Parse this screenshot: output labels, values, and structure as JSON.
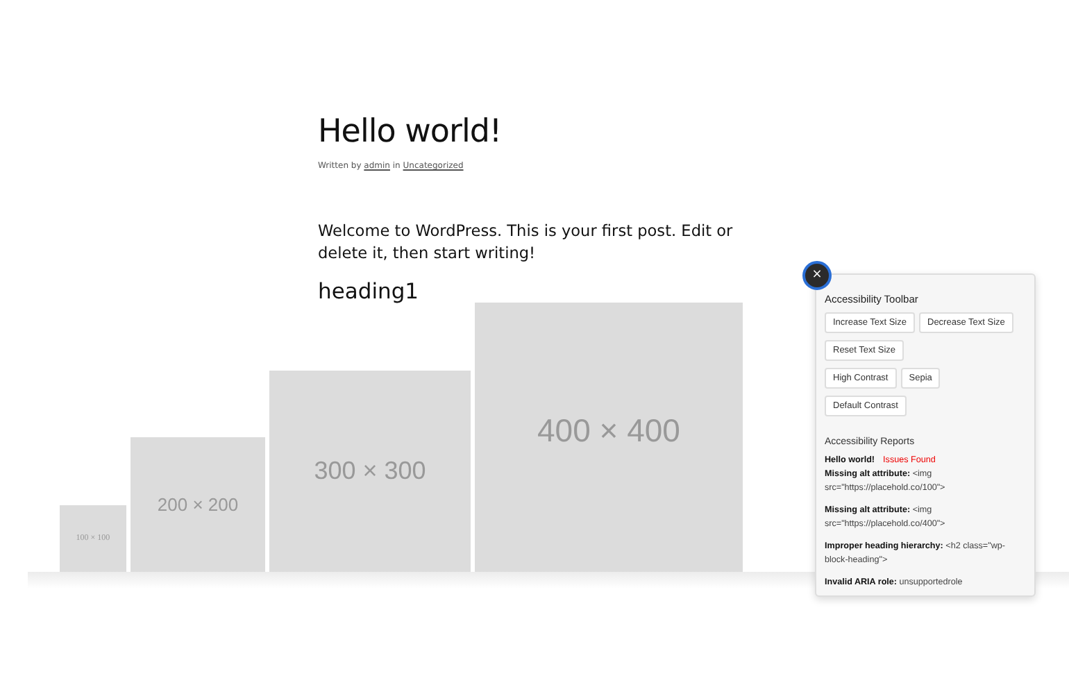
{
  "post": {
    "title": "Hello world!",
    "byline": {
      "prefix": "Written by",
      "author": "admin",
      "joiner": "in",
      "category": "Uncategorized"
    },
    "paragraph": "Welcome to WordPress. This is your first post. Edit or delete it, then start writing!",
    "heading": "heading1"
  },
  "images": [
    {
      "kind": "picture",
      "label": "100 × 100"
    },
    {
      "kind": "picture",
      "label": "200 × 200"
    },
    {
      "kind": "picture",
      "label": "300 × 300"
    },
    {
      "kind": "picture",
      "label": "400 × 400"
    }
  ],
  "toolbar": {
    "close": "×",
    "title": "Accessibility Toolbar",
    "button_rows": [
      [
        "Increase Text Size",
        "Decrease Text Size"
      ],
      [
        "Reset Text Size"
      ],
      [
        "High Contrast",
        "Sepia"
      ],
      [
        "Default Contrast"
      ]
    ],
    "reports_title": "Accessibility Reports",
    "report_heading": "Hello world!",
    "report_status": "Issues Found",
    "reports": [
      "**Missing alt attribute:** <img src=\"https://placehold.co/100\">",
      "**Missing alt attribute:** <img src=\"https://placehold.co/400\">",
      "**Improper heading hierarchy:** <h2 class=\"wp-block-heading\">",
      "**Invalid ARIA role:** unsupportedrole"
    ]
  }
}
